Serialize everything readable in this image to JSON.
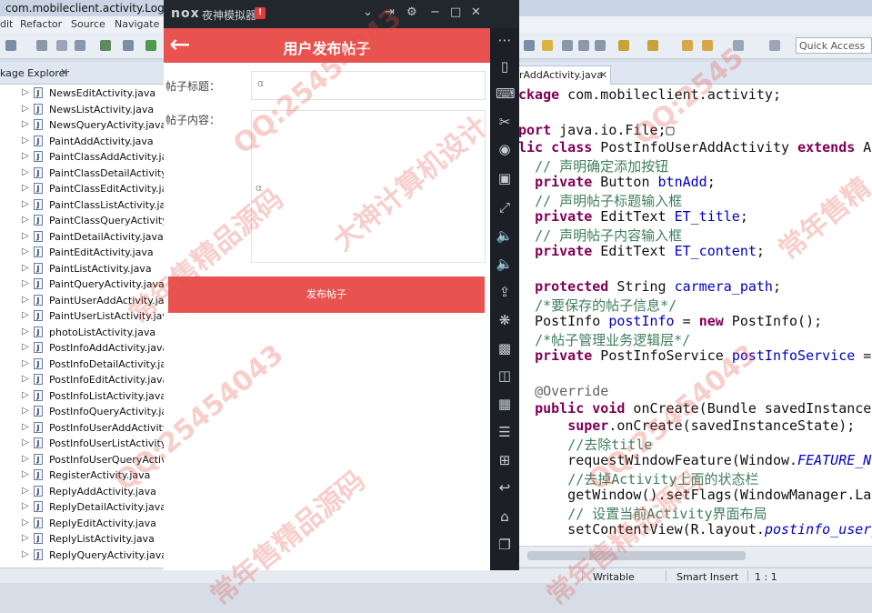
{
  "eclipse": {
    "title": "com.mobileclient.activity.LoginActi",
    "menu": [
      "dit",
      "Refactor",
      "Source",
      "Navigate"
    ],
    "quick_access": "Quick Access",
    "package_explorer": {
      "tab_label": "kage Explorer",
      "close": "✕",
      "files": [
        "NewsEditActivity.java",
        "NewsListActivity.java",
        "NewsQueryActivity.java",
        "PaintAddActivity.java",
        "PaintClassAddActivity.java",
        "PaintClassDetailActivity.ja",
        "PaintClassEditActivity.java",
        "PaintClassListActivity.java",
        "PaintClassQueryActivity.ja",
        "PaintDetailActivity.java",
        "PaintEditActivity.java",
        "PaintListActivity.java",
        "PaintQueryActivity.java",
        "PaintUserAddActivity.java",
        "PaintUserListActivity.java",
        "photoListActivity.java",
        "PostInfoAddActivity.java",
        "PostInfoDetailActivity.java",
        "PostInfoEditActivity.java",
        "PostInfoListActivity.java",
        "PostInfoQueryActivity.jav",
        "PostInfoUserAddActivity.j",
        "PostInfoUserListActivity.ja",
        "PostInfoUserQueryActivit",
        "RegisterActivity.java",
        "ReplyAddActivity.java",
        "ReplyDetailActivity.java",
        "ReplyEditActivity.java",
        "ReplyListActivity.java",
        "ReplyQueryActivity.java"
      ]
    },
    "editor": {
      "tab_label": "rAddActivity.java",
      "close": "✕"
    },
    "status": {
      "writable": "Writable",
      "insert_mode": "Smart Insert",
      "position": "1 : 1"
    }
  },
  "emulator": {
    "logo": "nox",
    "name": "夜神模拟器",
    "badge": "!",
    "app": {
      "back_icon": "←",
      "title": "用户发布帖子",
      "title_label": "帖子标题：",
      "content_label": "帖子内容：",
      "title_value": "",
      "content_value": "",
      "submit_label": "发布帖子"
    }
  },
  "watermarks": [
    "QQ:25454043",
    "大神计算机设计",
    "常年售精品源码",
    "QQ:25454043",
    "常年售精",
    "QQ:2545",
    "常年售精品源码",
    "QQ:25454043",
    "常年售精品源码"
  ]
}
